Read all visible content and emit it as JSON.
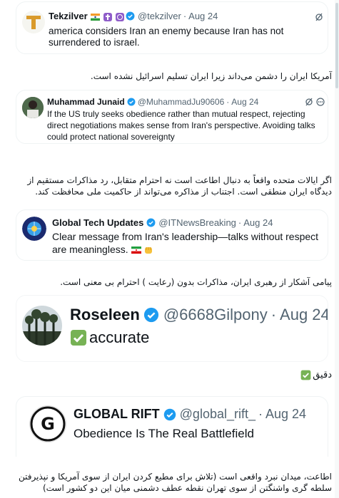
{
  "tweet1": {
    "name": "Tekzilver",
    "handle": "@tekzilver",
    "date": "Aug 24",
    "text": "america considers Iran an enemy because Iran has not surrendered to israel.",
    "translation": "آمریکا ایران را دشمن می‌داند زیرا ایران تسلیم اسرائیل نشده است."
  },
  "tweet2": {
    "name": "Muhammad Junaid",
    "handle": "@MuhammadJu90606",
    "date": "Aug 24",
    "text": "If the US truly seeks obedience rather than mutual respect, rejecting direct negotiations makes sense from Iran's perspective. Avoiding talks could protect national sovereignty",
    "translation": "اگر ایالات متحده واقعاً به دنبال اطاعت است نه احترام متقابل، رد مذاکرات مستقیم از دیدگاه ایران منطقی است. اجتناب از مذاکره می‌تواند از حاکمیت ملی محافظت کند."
  },
  "tweet3": {
    "name": "Global Tech Updates",
    "handle": "@ITNewsBreaking",
    "date": "Aug 24",
    "text": "Clear message from Iran's leadership—talks without respect are meaningless.",
    "translation": "پیامی آشکار از رهبری ایران، مذاکرات بدون (رعایت ) احترام بی معنی است."
  },
  "tweet4": {
    "name": "Roseleen",
    "handle": "@6668Gilpony",
    "date": "Aug 24",
    "text": "accurate",
    "translation": "دقیق"
  },
  "tweet5": {
    "name": "GLOBAL RIFT",
    "handle": "@global_rift_",
    "date": "Aug 24",
    "text": "Obedience Is The Real Battlefield",
    "avatar_letter": "G",
    "translation": "اطاعت، میدان نبرد واقعی است (تلاش برای مطیع کردن ایران از سوی آمریکا و نپذیرفتن سلطه گری واشنگتن از سوی تهران نقطه عطف دشمنی میان این دو کشور است)"
  },
  "separator": "·",
  "colors": {
    "verified": "#1d9bf0",
    "handle": "#536471",
    "border": "#eff3f4"
  }
}
